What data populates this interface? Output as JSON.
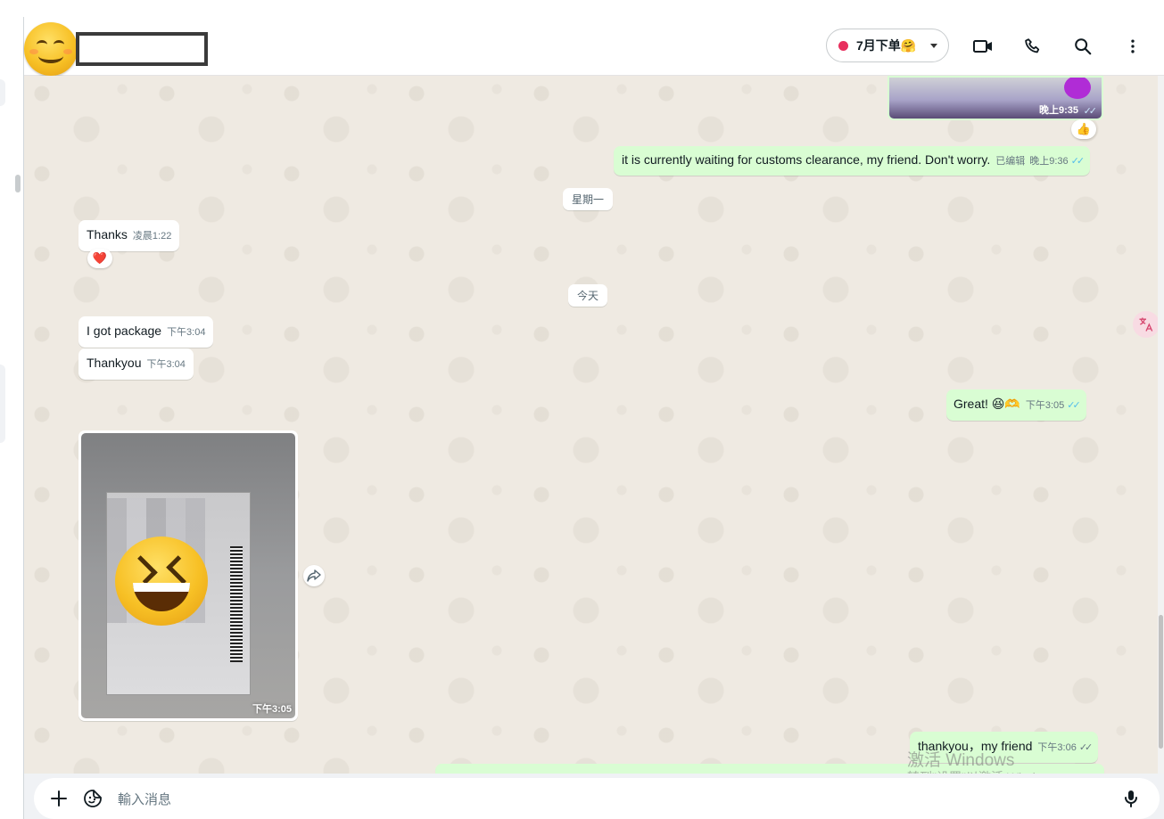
{
  "header": {
    "label_pill": "7月下单🤗"
  },
  "messages": {
    "top_image": {
      "time": "晚上9:35",
      "tick": "✓✓"
    },
    "top_reaction": "👍",
    "customs": {
      "text": "it is currently waiting for customs clearance, my friend. Don't worry.",
      "edited": "已编辑",
      "time": "晚上9:36",
      "tick": "✓✓"
    },
    "day_monday": "星期一",
    "thanks": {
      "text": "Thanks",
      "time": "凌晨1:22"
    },
    "thanks_reaction": "❤️",
    "day_today": "今天",
    "got_package": {
      "text": "I got package",
      "time": "下午3:04"
    },
    "thankyou": {
      "text": "Thankyou",
      "time": "下午3:04"
    },
    "great": {
      "text": "Great!",
      "emoji": "😆🫶",
      "time": "下午3:05",
      "tick": "✓✓"
    },
    "photo": {
      "time": "下午3:05"
    },
    "thankyou_friend": {
      "text": "thankyou，my friend",
      "time": "下午3:06",
      "tick": "✓✓"
    }
  },
  "watermark": {
    "line1": "激活 Windows",
    "line2": "转到\"设置\"以激活 Windows。"
  },
  "composer": {
    "placeholder": "輸入消息"
  },
  "icons": {
    "video": "video-call-icon",
    "phone": "phone-icon",
    "search": "search-icon",
    "menu": "more-vertical-icon",
    "plus": "plus-icon",
    "sticker": "sticker-icon",
    "mic": "microphone-icon",
    "forward": "forward-icon",
    "translate": "translate-icon"
  },
  "colors": {
    "outgoing_bubble": "#d9fdd3",
    "incoming_bubble": "#ffffff",
    "chat_bg": "#efeae2",
    "label_dot": "#e8305e",
    "read_tick": "#53bdeb"
  }
}
